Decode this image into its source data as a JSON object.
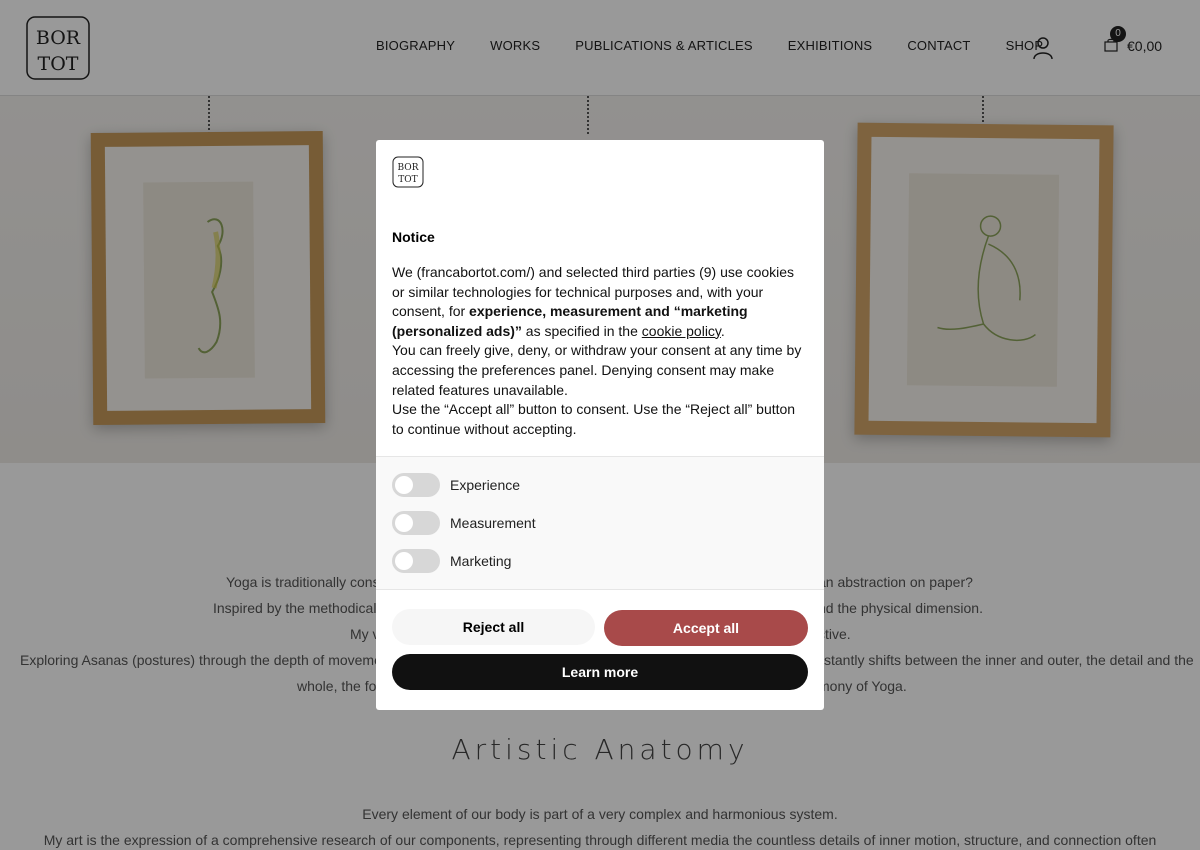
{
  "header": {
    "logo_alt": "BOR TOT",
    "logo_letters_top": "BOR",
    "logo_letters_bottom": "TOT",
    "nav": [
      "BIOGRAPHY",
      "WORKS",
      "PUBLICATIONS & ARTICLES",
      "EXHIBITIONS",
      "CONTACT",
      "SHOP"
    ],
    "cart_count": "0",
    "cart_total": "€0,00"
  },
  "content": {
    "para1_lines": [
      "Yoga is traditionally cons",
      "an abstraction on paper?",
      "Inspired by the methodical",
      "nd the physical dimension.",
      "My v",
      "ctive.",
      "Exploring Asanas (postures) through the depth of movemen",
      "stantly shifts between the inner and outer, the detail and the",
      "whole, the for",
      "mony of Yoga."
    ],
    "section_title": "Artistic Anatomy",
    "para2_lines": [
      "Every element of our body is part of a very complex and harmonious system.",
      "My art is the expression of a comprehensive research of our components, representing through different media the countless details of inner motion, structure, and connection often"
    ]
  },
  "modal": {
    "title": "Notice",
    "text_intro": "We (francabortot.com/) and selected third parties (9) use cookies or similar technologies for technical purposes and, with your consent, for ",
    "text_bold": "experience, measurement and “marketing (personalized ads)”",
    "text_after": " as specified in the ",
    "cookie_link": "cookie policy",
    "text_period": ".",
    "text_para2": "You can freely give, deny, or withdraw your consent at any time by accessing the preferences panel. Denying consent may make related features unavailable.",
    "text_para3": "Use the “Accept all” button to consent. Use the “Reject all” button to continue without accepting.",
    "toggles": [
      {
        "label": "Experience",
        "on": false
      },
      {
        "label": "Measurement",
        "on": false
      },
      {
        "label": "Marketing",
        "on": false
      }
    ],
    "reject_label": "Reject all",
    "accept_label": "Accept all",
    "learn_label": "Learn more",
    "accept_color": "#a84a4a"
  }
}
